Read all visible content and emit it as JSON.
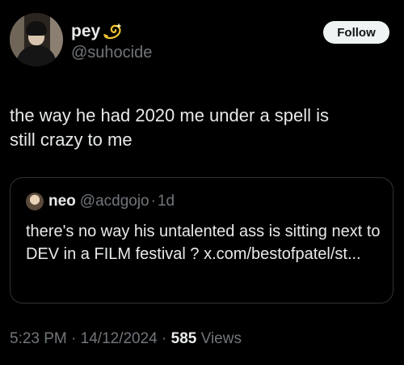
{
  "author": {
    "display_name": "pey",
    "handle": "@suhocide",
    "badge_icon": "dizzy-icon"
  },
  "follow_button": {
    "label": "Follow"
  },
  "tweet": {
    "text": "the way he had 2020 me under a spell is\nstill crazy to me"
  },
  "quoted_tweet": {
    "display_name": "neo",
    "handle": "@acdgojo",
    "separator": "·",
    "time": "1d",
    "text": "there's no way his untalented ass is sitting next to DEV in a FILM festival ? x.com/bestofpatel/st..."
  },
  "meta": {
    "time": "5:23 PM",
    "separator": "·",
    "date": "14/12/2024",
    "views_count": "585",
    "views_label": "Views"
  },
  "colors": {
    "background": "#000000",
    "text_primary": "#e7e9ea",
    "text_secondary": "#71767b",
    "border": "#2f3336",
    "button_bg": "#eff3f4"
  }
}
